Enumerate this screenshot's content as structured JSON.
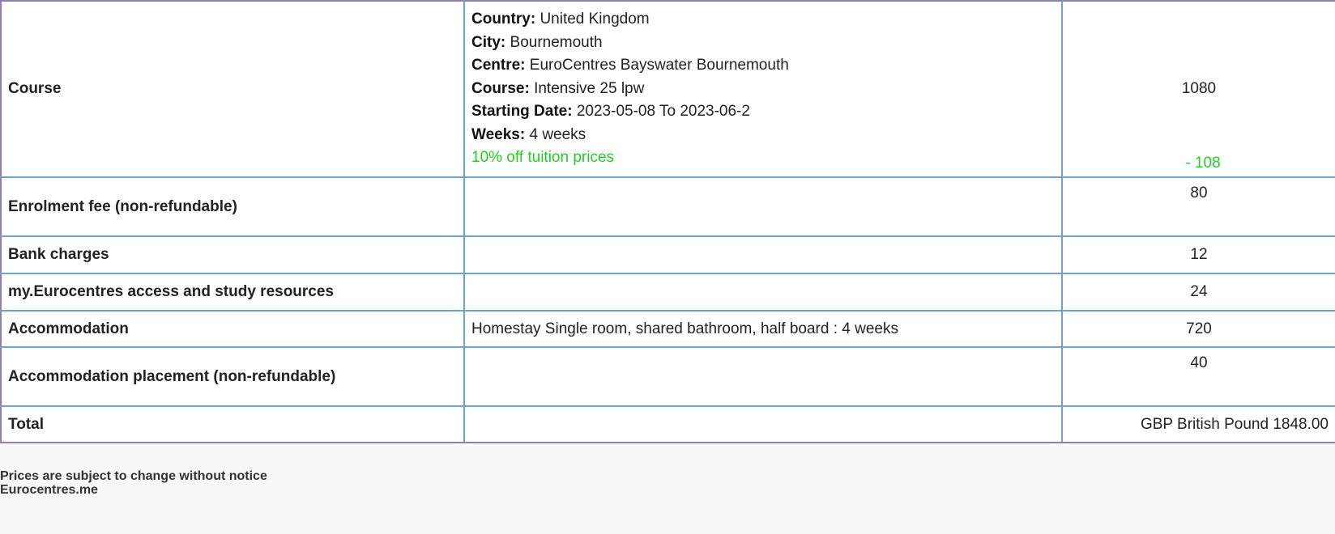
{
  "rows": {
    "course": {
      "label": "Course",
      "details": [
        {
          "key": "Country:",
          "value": "United Kingdom"
        },
        {
          "key": "City:",
          "value": "Bournemouth"
        },
        {
          "key": "Centre:",
          "value": "EuroCentres Bayswater Bournemouth"
        },
        {
          "key": "Course:",
          "value": "Intensive 25 lpw"
        },
        {
          "key": "Starting Date:",
          "value": "2023-05-08 To 2023-06-2"
        },
        {
          "key": "Weeks:",
          "value": "4 weeks"
        }
      ],
      "promo": "10% off tuition prices",
      "amount": "1080",
      "discount": "- 108"
    },
    "enrolment": {
      "label": "Enrolment fee (non-refundable)",
      "details": "",
      "amount": "80"
    },
    "bank": {
      "label": "Bank charges",
      "details": "",
      "amount": "12"
    },
    "resources": {
      "label": "my.Eurocentres access and study resources",
      "details": "",
      "amount": "24"
    },
    "accommodation": {
      "label": "Accommodation",
      "details": "Homestay Single room, shared bathroom, half board : 4 weeks",
      "amount": "720"
    },
    "placement": {
      "label": "Accommodation placement (non-refundable)",
      "details": "",
      "amount": "40"
    },
    "total": {
      "label": "Total",
      "details": "",
      "amount": "GBP British Pound 1848.00"
    }
  },
  "footer": {
    "notice": "Prices are subject to change without notice",
    "brand": "Eurocentres.me"
  },
  "colors": {
    "label": "#1a5ea8",
    "discount": "#1fd01f",
    "border": "#6fa3c9"
  }
}
